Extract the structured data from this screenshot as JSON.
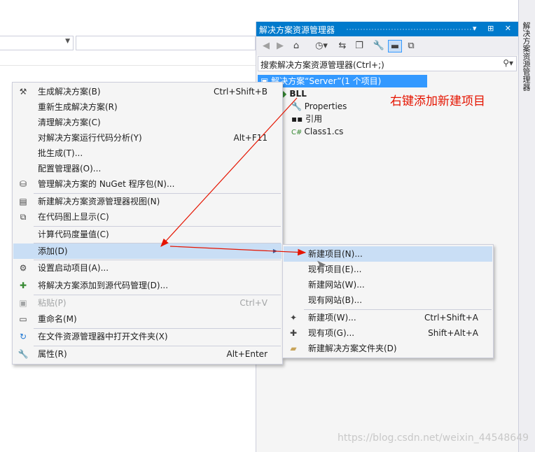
{
  "solution_explorer": {
    "title": "解决方案资源管理器",
    "title_buttons": "▾ ⊞ ✕",
    "search_placeholder": "搜索解决方案资源管理器(Ctrl+;)",
    "tree": [
      {
        "label": "解决方案“Server”(1 个项目)",
        "icon": "solution-icon",
        "selected": true
      },
      {
        "label": "BLL",
        "icon": "csharp-project-icon",
        "bold": true
      },
      {
        "label": "Properties",
        "icon": "wrench-icon"
      },
      {
        "label": "引用",
        "icon": "references-icon"
      },
      {
        "label": "Class1.cs",
        "icon": "csharp-file-icon"
      }
    ],
    "side_tab": "解决方案资源管理器"
  },
  "context_menu": {
    "items": [
      {
        "label": "生成解决方案(B)",
        "shortcut": "Ctrl+Shift+B",
        "icon": "build-icon"
      },
      {
        "label": "重新生成解决方案(R)",
        "shortcut": ""
      },
      {
        "label": "清理解决方案(C)",
        "shortcut": ""
      },
      {
        "label": "对解决方案运行代码分析(Y)",
        "shortcut": "Alt+F11"
      },
      {
        "label": "批生成(T)...",
        "shortcut": ""
      },
      {
        "label": "配置管理器(O)...",
        "shortcut": ""
      },
      {
        "label": "管理解决方案的 NuGet 程序包(N)...",
        "shortcut": "",
        "icon": "nuget-icon"
      },
      {
        "label": "新建解决方案资源管理器视图(N)",
        "shortcut": "",
        "icon": "new-view-icon"
      },
      {
        "label": "在代码图上显示(C)",
        "shortcut": "",
        "icon": "code-map-icon"
      },
      {
        "label": "计算代码度量值(C)",
        "shortcut": ""
      },
      {
        "label": "添加(D)",
        "shortcut": "",
        "has_submenu": true
      },
      {
        "label": "设置启动项目(A)...",
        "shortcut": "",
        "icon": "gear-icon"
      },
      {
        "label": "将解决方案添加到源代码管理(D)...",
        "shortcut": "",
        "icon": "source-control-icon"
      },
      {
        "label": "粘贴(P)",
        "shortcut": "Ctrl+V",
        "icon": "paste-icon",
        "disabled": true
      },
      {
        "label": "重命名(M)",
        "shortcut": "",
        "icon": "rename-icon"
      },
      {
        "label": "在文件资源管理器中打开文件夹(X)",
        "shortcut": "",
        "icon": "open-folder-icon"
      },
      {
        "label": "属性(R)",
        "shortcut": "Alt+Enter",
        "icon": "wrench-icon"
      }
    ]
  },
  "add_submenu": {
    "items": [
      {
        "label": "新建项目(N)...",
        "shortcut": ""
      },
      {
        "label": "现有项目(E)...",
        "shortcut": ""
      },
      {
        "label": "新建网站(W)...",
        "shortcut": ""
      },
      {
        "label": "现有网站(B)...",
        "shortcut": ""
      },
      {
        "label": "新建项(W)...",
        "shortcut": "Ctrl+Shift+A",
        "icon": "new-item-icon"
      },
      {
        "label": "现有项(G)...",
        "shortcut": "Shift+Alt+A",
        "icon": "existing-item-icon"
      },
      {
        "label": "新建解决方案文件夹(D)",
        "shortcut": "",
        "icon": "new-folder-icon"
      }
    ]
  },
  "annotation": "右键添加新建项目",
  "watermark": "https://blog.csdn.net/weixin_44548649",
  "colors": {
    "accent": "#007acc",
    "selection": "#3399ff",
    "highlight": "#c9def5",
    "annotation": "#e51400"
  }
}
